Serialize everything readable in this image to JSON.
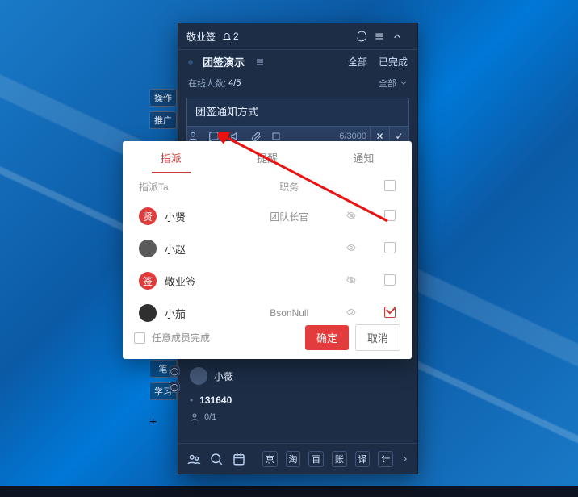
{
  "app": {
    "title": "敬业签",
    "notif_count": "2",
    "header": {
      "board": "团签演示",
      "filter_all": "全部",
      "filter_done": "已完成",
      "online_label": "在线人数:",
      "online_value": "4/5",
      "scope": "全部"
    },
    "input": {
      "text": "团签通知方式",
      "count": "6/3000"
    },
    "backlist": {
      "name": "小薇",
      "code": "131640",
      "sub": "0/1"
    },
    "bottom_chips": [
      "京",
      "淘",
      "百",
      "账",
      "译",
      "计"
    ]
  },
  "left_buttons": [
    "操作",
    "推广",
    "笔",
    "学习"
  ],
  "modal": {
    "tabs": {
      "assign": "指派",
      "remind": "提醒",
      "notify": "通知"
    },
    "active_tab": "assign",
    "head": {
      "c1": "指派Ta",
      "c2": "职务",
      "c4_icon": "chk"
    },
    "members": [
      {
        "avatar": "red",
        "avatar_txt": "贤",
        "name": "小贤",
        "role": "团队长官",
        "eye": "off",
        "checked": false
      },
      {
        "avatar": "grey",
        "avatar_txt": "",
        "name": "小赵",
        "role": "",
        "eye": "on",
        "checked": false
      },
      {
        "avatar": "redr",
        "avatar_txt": "签",
        "name": "敬业签",
        "role": "",
        "eye": "off",
        "checked": false
      },
      {
        "avatar": "dark",
        "avatar_txt": "",
        "name": "小茄",
        "role": "BsonNull",
        "eye": "on",
        "checked": true
      }
    ],
    "footer": {
      "any_label": "任意成员完成",
      "ok": "确定",
      "cancel": "取消"
    }
  }
}
